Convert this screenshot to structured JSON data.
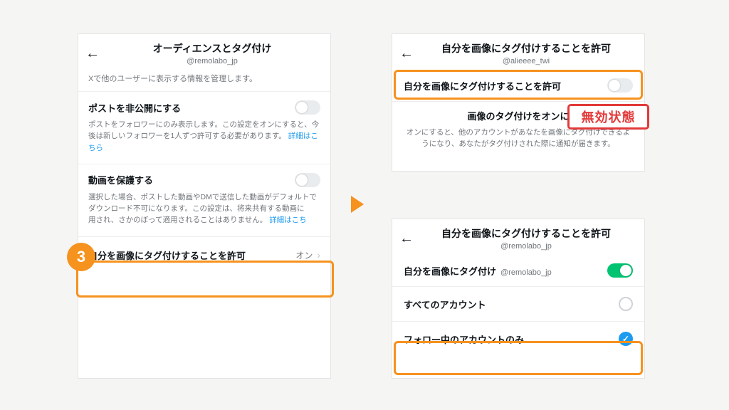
{
  "panel1": {
    "title": "オーディエンスとタグ付け",
    "handle": "@remolabo_jp",
    "subtext": "Xで他のユーザーに表示する情報を管理します。",
    "private": {
      "title": "ポストを非公開にする",
      "desc": "ポストをフォロワーにのみ表示します。この設定をオンにすると、今後は新しいフォロワーを1人ずつ許可する必要があります。",
      "link": "詳細はこちら"
    },
    "protect": {
      "title": "動画を保護する",
      "desc_a": "選択した場合、ポストした動画やDMで送信した動画がデフォルトでダウンロード不可になります。この設定は、将来共有する動画に",
      "desc_b": "用され、さかのぼって適用されることはありません。",
      "link": "詳細はこち"
    },
    "tag_row": {
      "label": "自分を画像にタグ付けすることを許可",
      "value": "オン"
    }
  },
  "badge_num": "3",
  "panel2": {
    "title": "自分を画像にタグ付けすることを許可",
    "handle": "@alieeee_twi",
    "row_label": "自分を画像にタグ付けすることを許可",
    "center_title_partial": "画像のタグ付けをオンに",
    "center_desc": "オンにすると、他のアカウントがあなたを画像にタグ付けできるようになり、あなたがタグ付けされた際に通知が届きます。"
  },
  "disabled_label": "無効状態",
  "panel3": {
    "title": "自分を画像にタグ付けすることを許可",
    "handle": "@remolabo_jp",
    "tag_label": "自分を画像にタグ付け",
    "tag_handle": "@remolabo_jp",
    "opt_all": "すべてのアカウント",
    "opt_follow": "フォロー中のアカウントのみ"
  }
}
